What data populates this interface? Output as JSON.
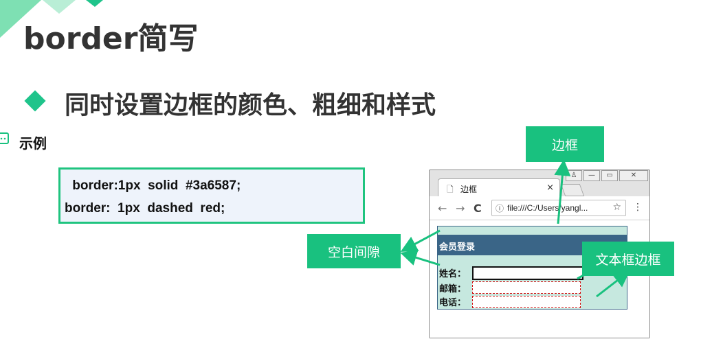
{
  "slide": {
    "title": "border简写",
    "subtitle": "同时设置边框的颜色、粗细和样式",
    "example_label": "示例"
  },
  "code_lines": [
    " border:1px  solid  #3a6587;",
    "border:  1px  dashed  red;"
  ],
  "browser": {
    "tab_title": "边框",
    "tab_close": "×",
    "url": "file:///C:/Users/yangl...",
    "window_buttons": [
      "♙",
      "—",
      "▭",
      "✕"
    ],
    "nav": {
      "back": "←",
      "forward": "→",
      "reload": "C",
      "info": "ⓘ",
      "star": "☆",
      "menu": "⋮"
    }
  },
  "form": {
    "title": "会员登录",
    "fields": [
      {
        "label": "姓名："
      },
      {
        "label": "邮箱："
      },
      {
        "label": "电话："
      }
    ]
  },
  "callouts": {
    "border": "边框",
    "padding": "空白间隙",
    "textbox_border": "文本框边框"
  },
  "colors": {
    "accent_green": "#19c17f",
    "header_blue": "#3a6587",
    "form_bg": "#c6e8df",
    "dashed_red": "#d01010"
  }
}
